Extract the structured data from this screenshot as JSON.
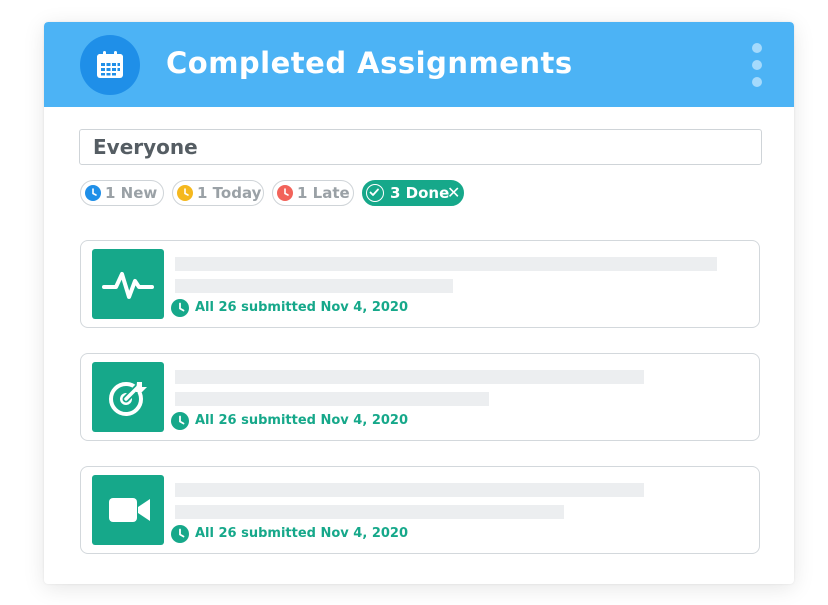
{
  "header": {
    "title": "Completed Assignments",
    "icon": "calendar-icon",
    "menu_icon": "more-vertical-icon",
    "background": "#4cb3f5"
  },
  "search": {
    "value": "Everyone"
  },
  "filters": [
    {
      "label": "1 New",
      "color": "#1f8fe8",
      "icon": "clock-icon",
      "active": false
    },
    {
      "label": "1 Today",
      "color": "#f5b81e",
      "icon": "clock-icon",
      "active": false
    },
    {
      "label": "1 Late",
      "color": "#f2635a",
      "icon": "clock-icon",
      "active": false
    },
    {
      "label": "3 Done",
      "color": "#16a88a",
      "icon": "check-icon",
      "active": true,
      "dismiss": "✕"
    }
  ],
  "assignments": [
    {
      "icon": "activity-pulse-icon",
      "status": "All 26 submitted Nov 4, 2020"
    },
    {
      "icon": "target-icon",
      "status": "All 26 submitted Nov 4, 2020"
    },
    {
      "icon": "video-camera-icon",
      "status": "All 26 submitted Nov 4, 2020"
    }
  ],
  "colors": {
    "accent_green": "#16a88a",
    "placeholder_bar": "#eceef0"
  }
}
